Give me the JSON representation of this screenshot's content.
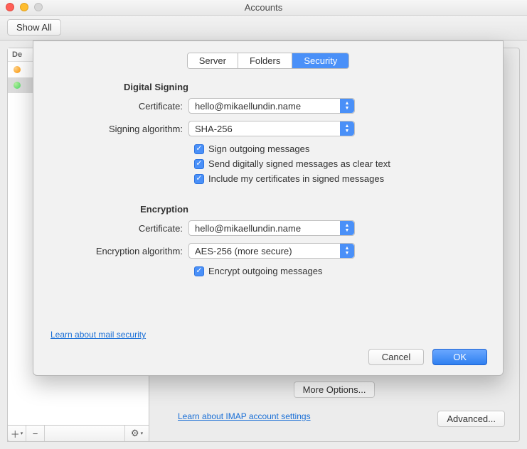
{
  "window": {
    "title": "Accounts"
  },
  "toolbar": {
    "show_all": "Show All"
  },
  "sidebar": {
    "header": "De",
    "items": [
      {
        "label": ""
      },
      {
        "label": ""
      }
    ],
    "footer": {
      "add": "+",
      "remove": "−",
      "gear": "⚙"
    }
  },
  "rightpane": {
    "more_options": "More Options...",
    "link": "Learn about IMAP account settings",
    "advanced": "Advanced..."
  },
  "sheet": {
    "tabs": {
      "server": "Server",
      "folders": "Folders",
      "security": "Security"
    },
    "signing": {
      "title": "Digital Signing",
      "cert_label": "Certificate:",
      "cert_value": "hello@mikaellundin.name",
      "algo_label": "Signing algorithm:",
      "algo_value": "SHA-256",
      "chk1": "Sign outgoing messages",
      "chk2": "Send digitally signed messages as clear text",
      "chk3": "Include my certificates in signed messages"
    },
    "encryption": {
      "title": "Encryption",
      "cert_label": "Certificate:",
      "cert_value": "hello@mikaellundin.name",
      "algo_label": "Encryption algorithm:",
      "algo_value": "AES-256 (more secure)",
      "chk1": "Encrypt outgoing messages"
    },
    "link": "Learn about mail security",
    "cancel": "Cancel",
    "ok": "OK"
  }
}
